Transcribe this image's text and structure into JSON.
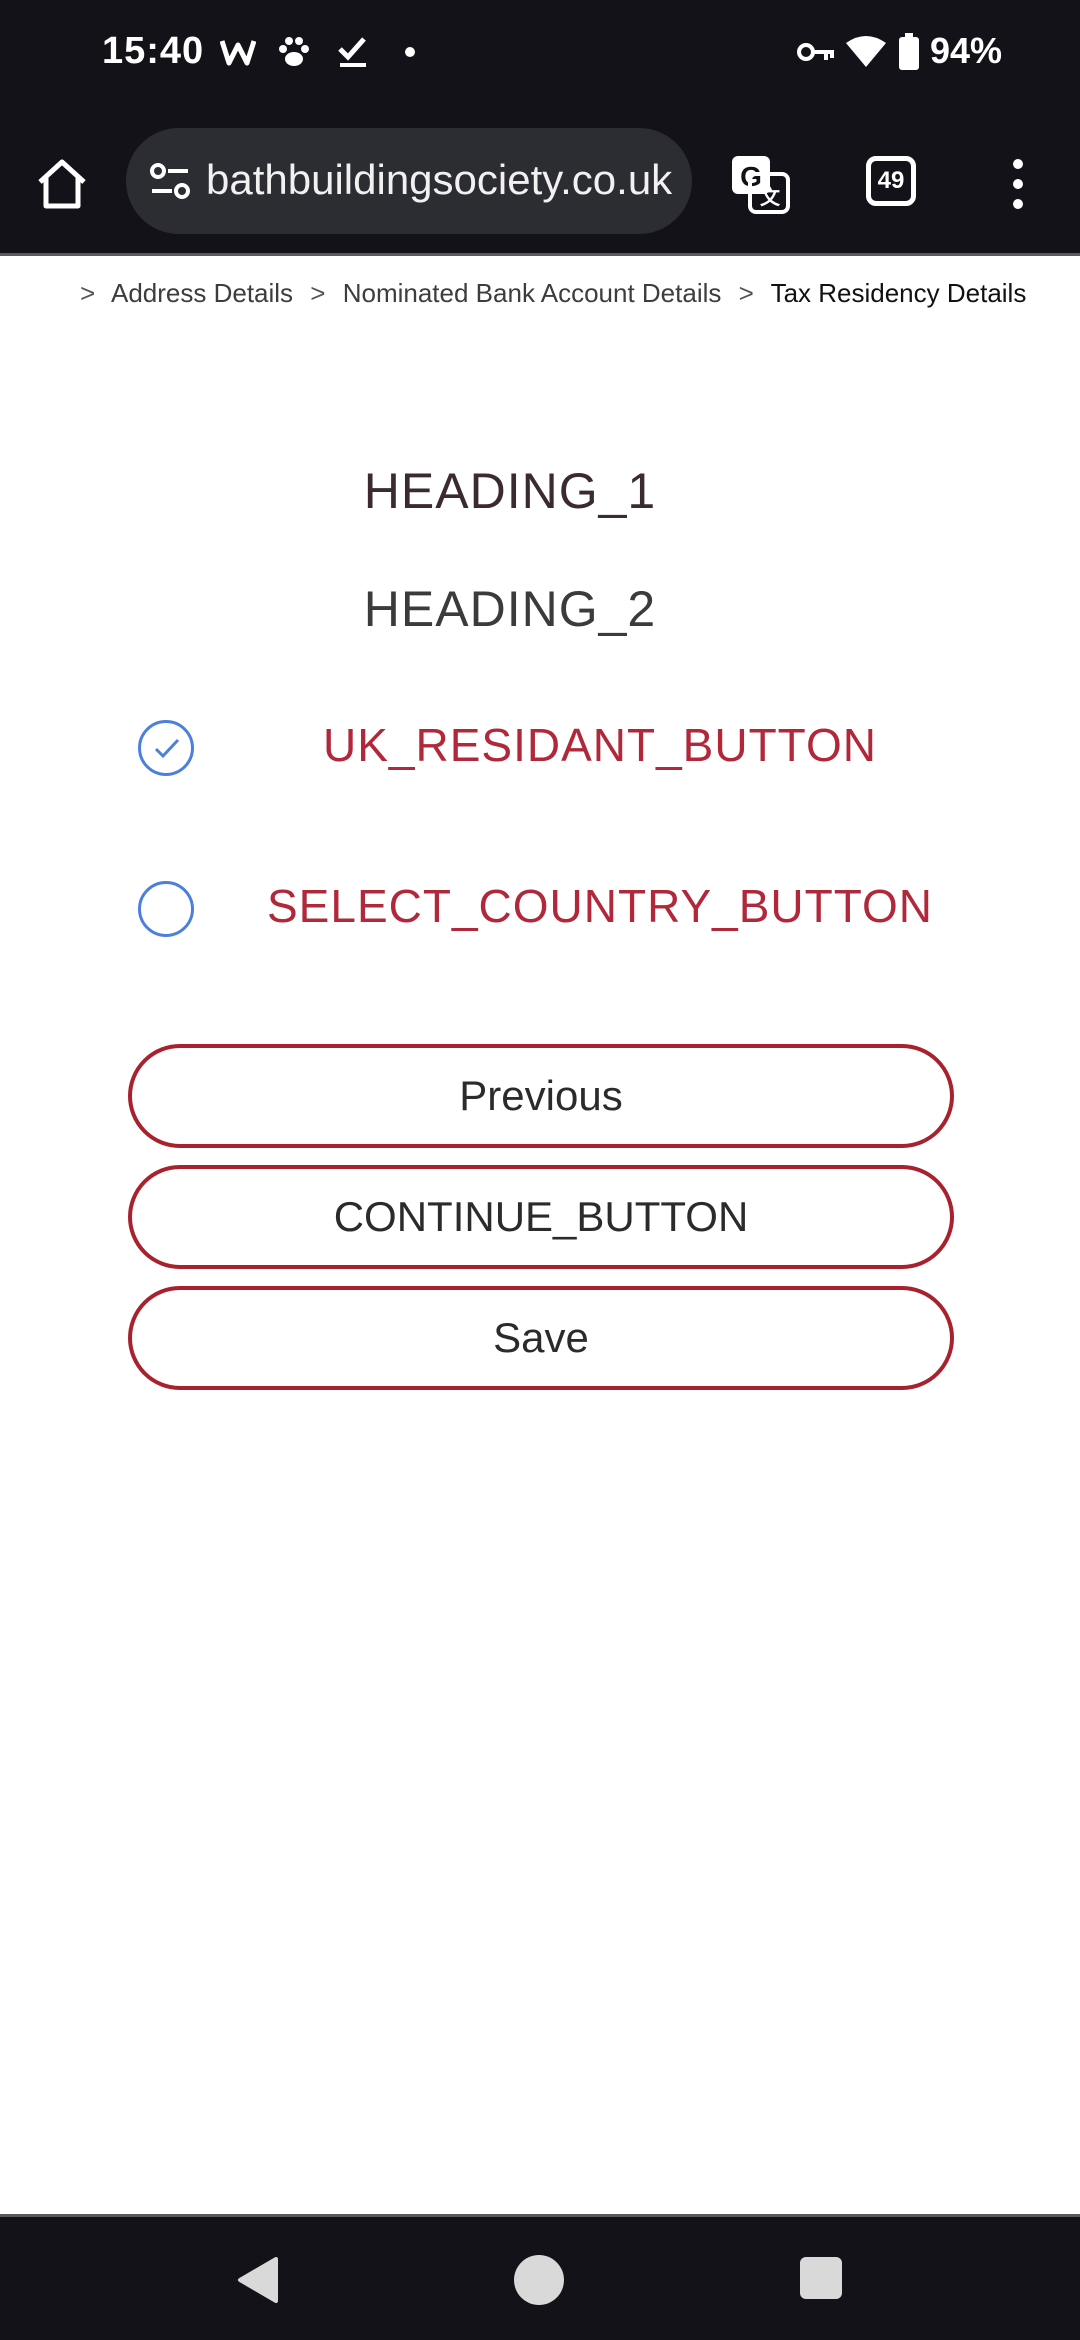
{
  "status_bar": {
    "time": "15:40",
    "notification_icons": [
      "w-icon",
      "paw-icon",
      "check-icon",
      "dot-icon"
    ],
    "battery_text": "94%"
  },
  "browser": {
    "url": "bathbuildingsociety.co.uk",
    "tab_count": "49"
  },
  "breadcrumb": {
    "sep": ">",
    "items": [
      "Address Details",
      "Nominated Bank Account Details",
      "Tax Residency Details"
    ]
  },
  "content": {
    "heading_1": "HEADING_1",
    "heading_2": "HEADING_2",
    "options": [
      {
        "label": "UK_RESIDANT_BUTTON",
        "selected": true
      },
      {
        "label": "SELECT_COUNTRY_BUTTON",
        "selected": false
      }
    ],
    "buttons": {
      "previous": "Previous",
      "continue": "CONTINUE_BUTTON",
      "save": "Save"
    }
  },
  "colors": {
    "accent_red": "#a8222e",
    "radio_blue": "#4d7fdc",
    "chrome_dark": "#131218"
  }
}
